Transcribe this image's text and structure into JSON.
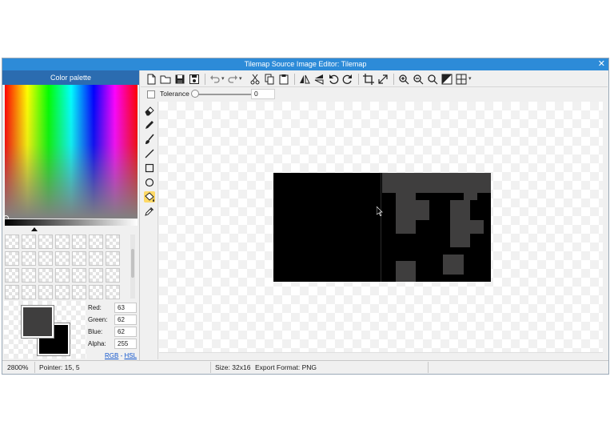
{
  "window": {
    "title": "Tilemap Source Image Editor: Tilemap",
    "close_glyph": "✕"
  },
  "palette": {
    "header": "Color palette",
    "primary_color": "#3f3e3e",
    "secondary_color": "#000000",
    "rgba": [
      {
        "label": "Red:",
        "value": "63"
      },
      {
        "label": "Green:",
        "value": "62"
      },
      {
        "label": "Blue:",
        "value": "62"
      },
      {
        "label": "Alpha:",
        "value": "255"
      }
    ],
    "mode_rgb": "RGB",
    "mode_sep": "-",
    "mode_hsl": "HSL"
  },
  "toolbar": {
    "buttons": [
      "new-file-icon",
      "open-folder-icon",
      "save-icon",
      "save-as-icon",
      "undo-icon",
      "redo-icon",
      "cut-icon",
      "copy-icon",
      "paste-icon",
      "flip-horizontal-icon",
      "flip-vertical-icon",
      "rotate-left-icon",
      "rotate-right-icon",
      "crop-icon",
      "resize-icon",
      "zoom-in-icon",
      "zoom-out-icon",
      "zoom-fit-icon",
      "transparency-icon",
      "grid-icon"
    ],
    "dropdown_glyph": "▾"
  },
  "tolerance": {
    "label": "Tolerance",
    "value": "0",
    "checked": false
  },
  "tools": [
    "eraser-icon",
    "pencil-icon",
    "brush-icon",
    "line-icon",
    "rectangle-icon",
    "ellipse-icon",
    "fill-bucket-icon",
    "eyedropper-icon"
  ],
  "active_tool": "fill-bucket-icon",
  "status": {
    "zoom": "2800%",
    "pointer": "Pointer: 15, 5",
    "size": "Size: 32x16",
    "export_format": "Export Format: PNG"
  },
  "colors": {
    "title_bar": "#2d8bd8",
    "palette_header": "#2b6cb0",
    "pixel_gray": "#3f3e3e",
    "active_tool_bg": "#ffd966"
  }
}
